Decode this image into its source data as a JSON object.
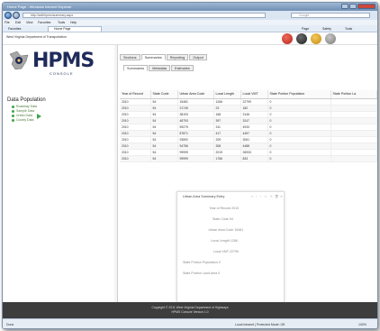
{
  "window": {
    "title": "Home Page - Windows Internet Explorer"
  },
  "address": {
    "url": "http://wdt/hpms/summary.aspx",
    "search_placeholder": "Google"
  },
  "menu": [
    "File",
    "Edit",
    "View",
    "Favorites",
    "Tools",
    "Help"
  ],
  "favorites": {
    "label": "Favorites",
    "tab_title": "Home Page",
    "commands": [
      "Page",
      "Safety",
      "Tools"
    ]
  },
  "header": {
    "org_title": "West Virginia Department of Transportation"
  },
  "logo": {
    "name": "HPMS",
    "subtitle": "CONSOLE"
  },
  "sidebar": {
    "heading": "Data Population",
    "items": [
      {
        "label": "Roadway Data"
      },
      {
        "label": "Sample Data"
      },
      {
        "label": "Urban Data"
      },
      {
        "label": "County Data"
      }
    ]
  },
  "tabs": {
    "main": [
      {
        "label": "Sections"
      },
      {
        "label": "Summaries"
      },
      {
        "label": "Reporting"
      },
      {
        "label": "Output"
      }
    ],
    "sub": [
      {
        "label": "Summaries"
      },
      {
        "label": "Metadata"
      },
      {
        "label": "Estimates"
      }
    ]
  },
  "table": {
    "columns": [
      "Year of Record",
      "State Code",
      "Urban Area Code",
      "Local Length",
      "Local VMT",
      "State Portion Population",
      "State Portion La"
    ],
    "rows": [
      [
        "2010",
        "54",
        "15481",
        "1266",
        "22799",
        "0",
        ""
      ],
      [
        "2010",
        "54",
        "21745",
        "23",
        "182",
        "0",
        ""
      ],
      [
        "2010",
        "54",
        "38193",
        "168",
        "3146",
        "0",
        ""
      ],
      [
        "2010",
        "54",
        "48793",
        "397",
        "3247",
        "0",
        ""
      ],
      [
        "2010",
        "54",
        "59275",
        "311",
        "4933",
        "0",
        ""
      ],
      [
        "2010",
        "54",
        "87871",
        "417",
        "4497",
        "0",
        ""
      ],
      [
        "2010",
        "54",
        "93592",
        "209",
        "3061",
        "0",
        ""
      ],
      [
        "2010",
        "54",
        "94756",
        "308",
        "4488",
        "0",
        ""
      ],
      [
        "2010",
        "54",
        "99999",
        "2019",
        "26933",
        "0",
        ""
      ],
      [
        "2010",
        "54",
        "99999",
        "1766",
        "833",
        "0",
        ""
      ]
    ]
  },
  "popup": {
    "title": "Urban Area Summary Entry",
    "controls": [
      "«",
      "‹",
      "›",
      "»",
      "✎",
      "🗑",
      "✕"
    ],
    "fields": [
      {
        "label": "Year of Record",
        "value": "2010"
      },
      {
        "label": "State Code",
        "value": "54"
      },
      {
        "label": "Urban Area Code",
        "value": "15481"
      },
      {
        "label": "Local Length",
        "value": "1266"
      },
      {
        "label": "Local VMT",
        "value": "22799"
      },
      {
        "label": "State Portion Population",
        "value": "0"
      },
      {
        "label": "State Portion Land Area",
        "value": "0"
      }
    ]
  },
  "footer": {
    "line1": "Copyright © 2011 West Virginia Department of Highways",
    "line2": "HPMS Console Version 1.0"
  },
  "status": {
    "left": "Done",
    "zone": "Local intranet | Protected Mode: Off",
    "zoom": "100%"
  },
  "colors": {
    "accent_green": "#3fa44b",
    "logo_navy": "#1f2b5a",
    "footer_bg": "#3d3d3d"
  }
}
